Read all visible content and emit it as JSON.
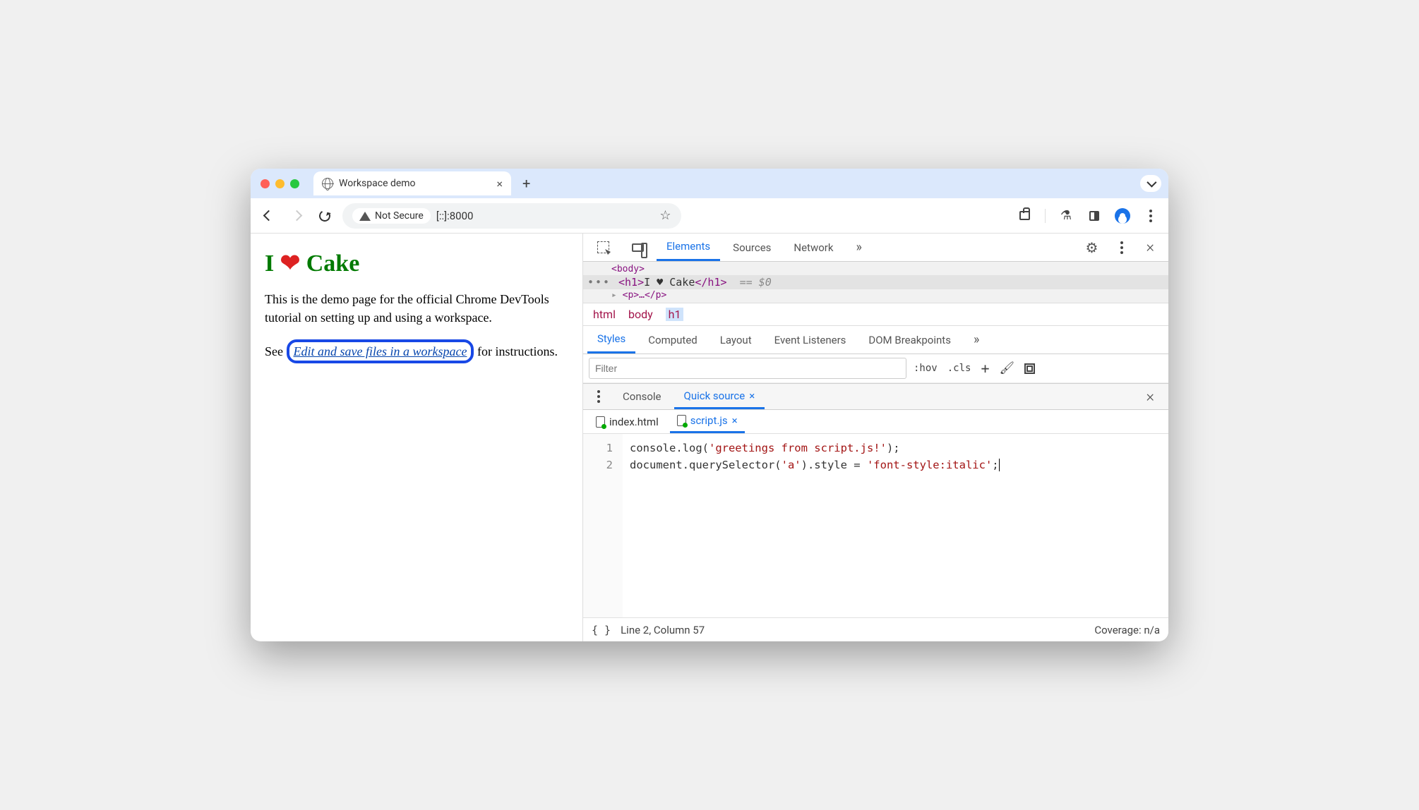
{
  "window": {
    "tab_title": "Workspace demo"
  },
  "omnibox": {
    "security_label": "Not Secure",
    "url": "[::]:8000"
  },
  "page": {
    "h1_pre": "I ",
    "h1_heart": "❤",
    "h1_post": " Cake",
    "intro": "This is the demo page for the official Chrome DevTools tutorial on setting up and using a workspace.",
    "see_pre": "See ",
    "link_text": "Edit and save files in a workspace",
    "see_post": " for instructions."
  },
  "devtools": {
    "tabs": {
      "elements": "Elements",
      "sources": "Sources",
      "network": "Network"
    },
    "dom": {
      "prev": "<body>",
      "sel_open": "<h1>",
      "sel_text": "I ♥ Cake",
      "sel_close": "</h1>",
      "sel_eq": "== $0",
      "next": "<p>…</p>"
    },
    "breadcrumb": [
      "html",
      "body",
      "h1"
    ],
    "styles_tabs": {
      "styles": "Styles",
      "computed": "Computed",
      "layout": "Layout",
      "listeners": "Event Listeners",
      "dom_bp": "DOM Breakpoints"
    },
    "filter_placeholder": "Filter",
    "styles_btns": {
      "hov": ":hov",
      "cls": ".cls"
    },
    "drawer_tabs": {
      "console": "Console",
      "quick": "Quick source"
    },
    "files": {
      "index": "index.html",
      "script": "script.js"
    },
    "code": {
      "line1_a": "console.log(",
      "line1_str": "'greetings from script.js!'",
      "line1_b": ");",
      "line2_a": "document.querySelector(",
      "line2_str1": "'a'",
      "line2_b": ").style = ",
      "line2_str2": "'font-style:italic'",
      "line2_c": ";"
    },
    "status": {
      "pos": "Line 2, Column 57",
      "coverage": "Coverage: n/a"
    }
  }
}
